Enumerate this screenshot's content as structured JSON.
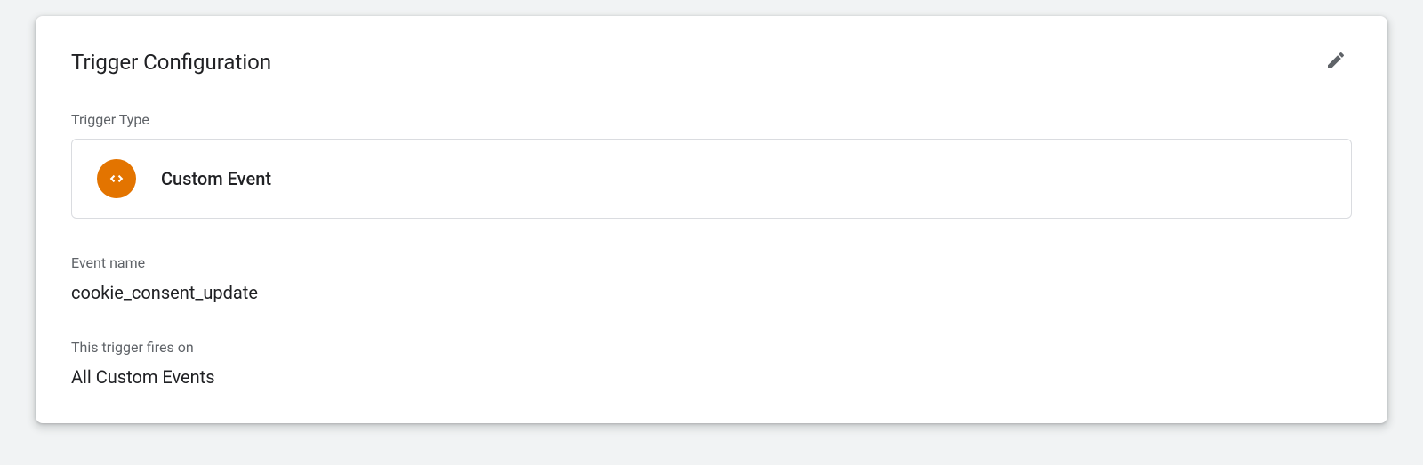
{
  "card": {
    "title": "Trigger Configuration",
    "triggerTypeLabel": "Trigger Type",
    "triggerType": {
      "name": "Custom Event"
    },
    "eventNameLabel": "Event name",
    "eventNameValue": "cookie_consent_update",
    "firesOnLabel": "This trigger fires on",
    "firesOnValue": "All Custom Events"
  }
}
